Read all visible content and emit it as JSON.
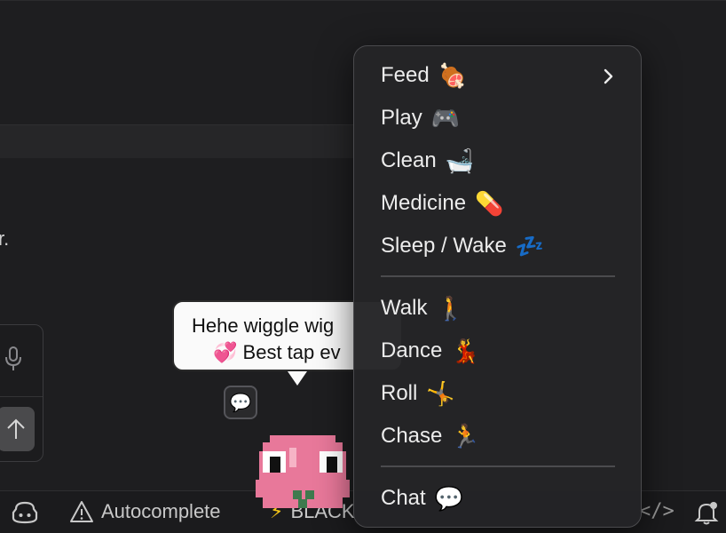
{
  "background": {
    "text_fragment": "r."
  },
  "status_bar": {
    "autocomplete_label": "Autocomplete",
    "black_label": "BLACK",
    "code_label": "</>"
  },
  "bubble": {
    "line1": "Hehe wiggle wig",
    "line2_emoji": "💞",
    "line2": "Best tap ev"
  },
  "chat_chip": {
    "icon": "speech-bubble-icon"
  },
  "menu": {
    "items": [
      {
        "label": "Feed",
        "emoji": "🍖",
        "submenu": true
      },
      {
        "label": "Play",
        "emoji": "🎮"
      },
      {
        "label": "Clean",
        "emoji": "🛁"
      },
      {
        "label": "Medicine",
        "emoji": "💊"
      },
      {
        "label": "Sleep / Wake",
        "emoji": "💤"
      },
      {
        "label": "Walk",
        "emoji": "🚶"
      },
      {
        "label": "Dance",
        "emoji": "💃"
      },
      {
        "label": "Roll",
        "emoji": "🤸"
      },
      {
        "label": "Chase",
        "emoji": "🏃"
      },
      {
        "label": "Chat",
        "emoji": "💬"
      }
    ]
  },
  "colors": {
    "background": "#1e1e20",
    "menu_bg": "#242426",
    "pet_pink": "#e8789a",
    "bubble_bg": "#fafafa"
  }
}
